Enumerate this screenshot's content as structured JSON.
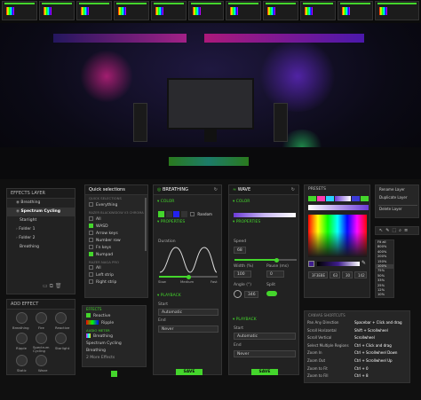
{
  "effects_layer": {
    "title": "EFFECTS LAYER",
    "items": [
      "Breathing",
      "Spectrum Cycling",
      "Starlight",
      "Folder 1",
      "Folder 2",
      "Breathing"
    ],
    "add_effect_title": "ADD EFFECT",
    "effects": [
      "Breathing",
      "Fire",
      "Reactive",
      "Ripple",
      "Spectrum Cycling",
      "Starlight",
      "Static",
      "Wave"
    ]
  },
  "quick_selections": {
    "title": "Quick selections",
    "section1": "QUICK SELECTIONS",
    "everything": "Everything",
    "section2": "RAZER BLACKWIDOW V3 CHROMA",
    "items": [
      "All",
      "WASD",
      "Arrow keys",
      "Number row",
      "Fn keys",
      "Numpad"
    ],
    "section3": "RAZER NAGA PRO",
    "mouse_items": [
      "All",
      "Left strip",
      "Right strip"
    ]
  },
  "layers_mini": {
    "title": "EFFECTS",
    "reactive": "Reactive",
    "ripple": "Ripple",
    "section": "AUDIO METER",
    "breathing": "Breathing",
    "spectrum": "Spectrum Cycling",
    "breathing2": "Breathing",
    "more": "2 More Effects"
  },
  "breathing_panel": {
    "title": "BREATHING",
    "color_label": "COLOR",
    "random": "Random",
    "properties": "PROPERTIES",
    "duration": "Duration",
    "slow": "Slow",
    "medium": "Medium",
    "fast": "Fast",
    "playback": "PLAYBACK",
    "start": "Start",
    "start_value": "Automatic",
    "end": "End",
    "end_value": "Never",
    "save": "SAVE"
  },
  "wave_panel": {
    "title": "WAVE",
    "color_label": "COLOR",
    "properties": "PROPERTIES",
    "speed": "Speed",
    "speed_value": "68",
    "width": "Width (%)",
    "width_value": "100",
    "pause": "Pause (ms)",
    "pause_value": "0",
    "angle": "Angle (°)",
    "angle_value": "346",
    "split": "Split",
    "playback": "PLAYBACK",
    "start": "Start",
    "start_value": "Automatic",
    "end": "End",
    "end_value": "Never",
    "save": "SAVE"
  },
  "color_picker": {
    "title": "PRESETS",
    "hex": "3F3E8E",
    "r": "63",
    "g": "30",
    "b": "142"
  },
  "context_menu": {
    "items": [
      "Rename Layer",
      "Duplicate Layer",
      "Delete Layer"
    ]
  },
  "zoom_list": {
    "items": [
      "Fit all",
      "800%",
      "400%",
      "200%",
      "150%",
      "100%",
      "75%",
      "50%",
      "33%",
      "25%",
      "12%",
      "10%"
    ]
  },
  "shortcuts": {
    "title": "CANVAS SHORTCUTS",
    "rows": [
      [
        "Pan Any Direction",
        "Spacebar + Click and drag"
      ],
      [
        "Scroll Horizontal",
        "Shift + Scrollwheel"
      ],
      [
        "Scroll Vertical",
        "Scrollwheel"
      ],
      [
        "Select Multiple Regions",
        "Ctrl + Click and drag"
      ],
      [
        "Zoom In",
        "Ctrl + Scrollwheel Down"
      ],
      [
        "Zoom Out",
        "Ctrl + Scrollwheel Up"
      ],
      [
        "Zoom to Fit",
        "Ctrl + 0"
      ],
      [
        "Zoom to Fill",
        "Ctrl + 8"
      ]
    ]
  },
  "colors": {
    "accent": "#44d62c",
    "panel": "#222222",
    "background": "#101010"
  }
}
